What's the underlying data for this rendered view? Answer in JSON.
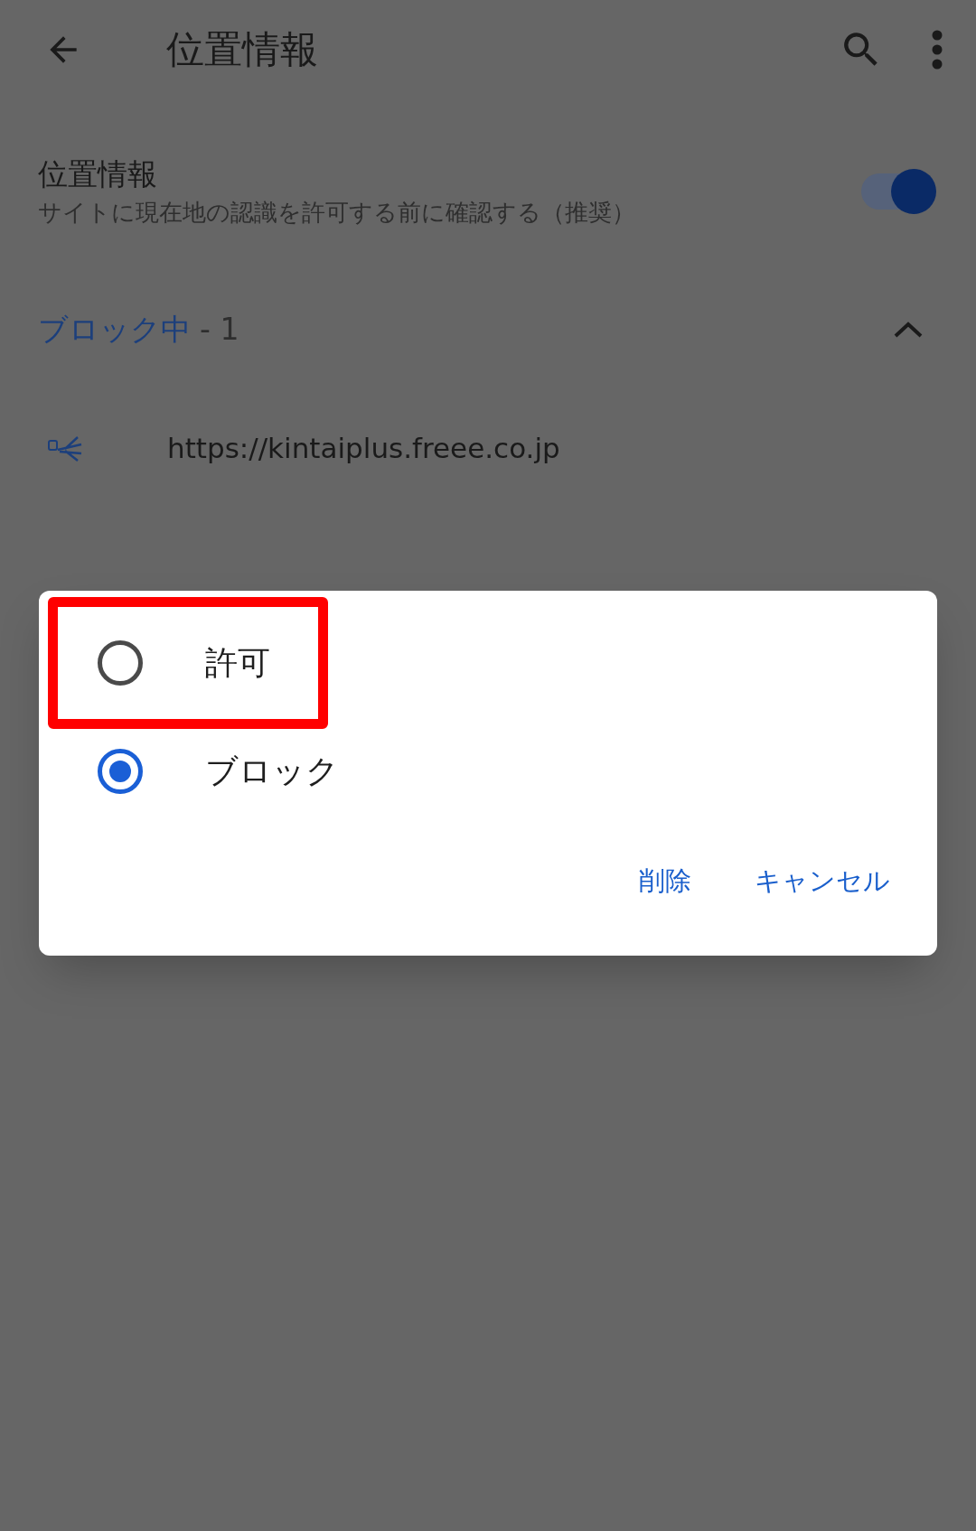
{
  "app_bar": {
    "title": "位置情報"
  },
  "setting": {
    "title": "位置情報",
    "subtitle": "サイトに現在地の認識を許可する前に確認する（推奨）",
    "on": true
  },
  "section": {
    "label": "ブロック中",
    "count": "- 1",
    "expanded": true
  },
  "sites": [
    {
      "url": "https://kintaiplus.freee.co.jp"
    }
  ],
  "dialog": {
    "options": [
      {
        "label": "許可",
        "selected": false,
        "highlighted": true
      },
      {
        "label": "ブロック",
        "selected": true,
        "highlighted": false
      }
    ],
    "buttons": [
      "削除",
      "キャンセル"
    ]
  }
}
